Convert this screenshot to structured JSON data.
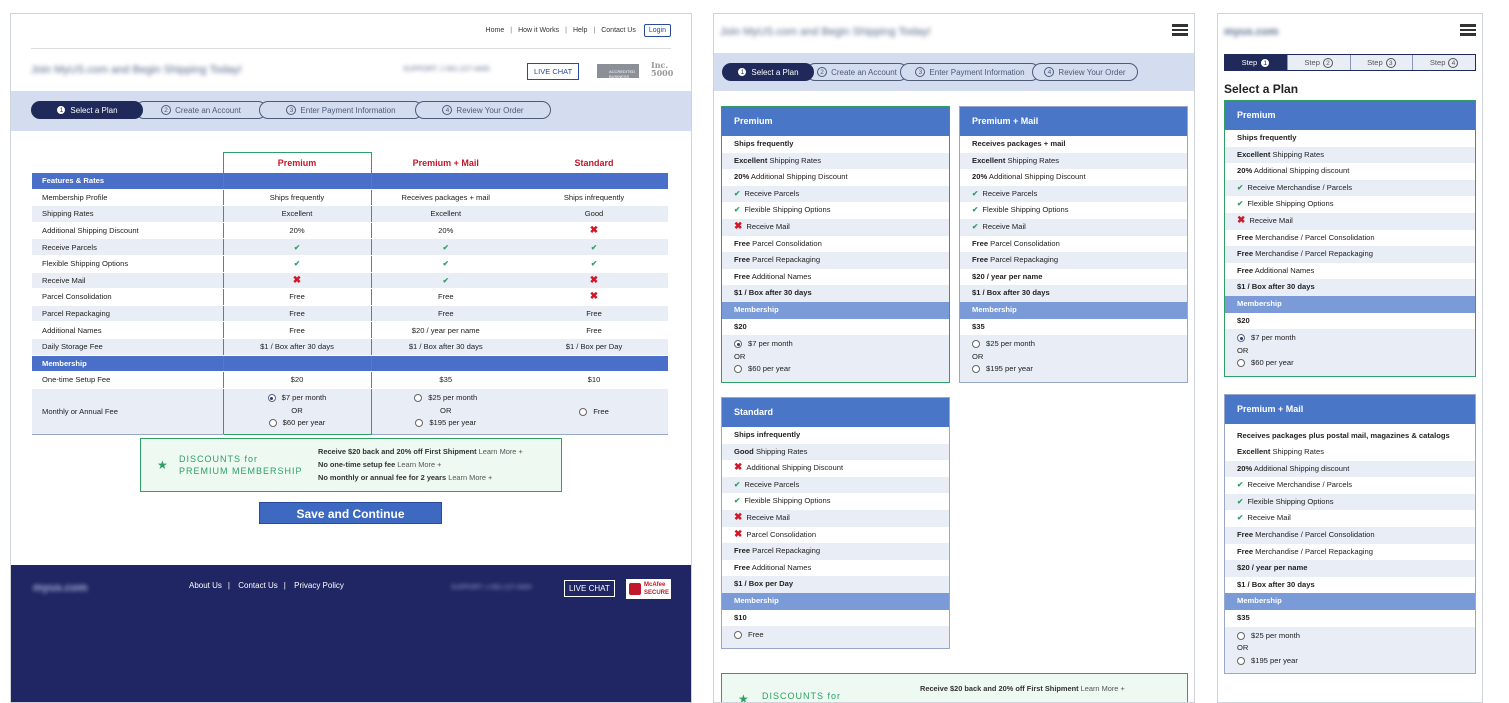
{
  "nav": {
    "home": "Home",
    "how": "How it Works",
    "help": "Help",
    "contact": "Contact Us",
    "login": "Login"
  },
  "brand": {
    "tagline": "Join MyUS.com and Begin Shipping Today!",
    "support": "SUPPORT: 1-561-227-4400",
    "live_chat": "LIVE CHAT",
    "inc": "Inc. 5000",
    "bbb": "ACCREDITED BUSINESS"
  },
  "steps": [
    {
      "num": "1",
      "label": "Select a Plan"
    },
    {
      "num": "2",
      "label": "Create an Account"
    },
    {
      "num": "3",
      "label": "Enter Payment Information"
    },
    {
      "num": "4",
      "label": "Review Your Order"
    }
  ],
  "plans": [
    "Premium",
    "Premium + Mail",
    "Standard"
  ],
  "table": {
    "features_header": "Features & Rates",
    "membership_header": "Membership",
    "rows": [
      {
        "label": "Membership Profile",
        "cells": [
          "Ships frequently",
          "Receives packages + mail",
          "Ships infrequently"
        ]
      },
      {
        "label": "Shipping Rates",
        "cells": [
          "Excellent",
          "Excellent",
          "Good"
        ]
      },
      {
        "label": "Additional Shipping Discount",
        "cells": [
          "20%",
          "20%",
          "✖"
        ]
      },
      {
        "label": "Receive Parcels",
        "cells": [
          "✔",
          "✔",
          "✔"
        ]
      },
      {
        "label": "Flexible Shipping Options",
        "cells": [
          "✔",
          "✔",
          "✔"
        ]
      },
      {
        "label": "Receive Mail",
        "cells": [
          "✖",
          "✔",
          "✖"
        ]
      },
      {
        "label": "Parcel Consolidation",
        "cells": [
          "Free",
          "Free",
          "✖"
        ]
      },
      {
        "label": "Parcel Repackaging",
        "cells": [
          "Free",
          "Free",
          "Free"
        ]
      },
      {
        "label": "Additional Names",
        "cells": [
          "Free",
          "$20 / year per name",
          "Free"
        ]
      },
      {
        "label": "Daily Storage Fee",
        "cells": [
          "$1 / Box after 30 days",
          "$1 / Box after 30 days",
          "$1 / Box per Day"
        ]
      }
    ],
    "setup_label": "One-time Setup Fee",
    "setup": [
      "$20",
      "$35",
      "$10"
    ],
    "fee_label": "Monthly or Annual Fee",
    "or": "OR",
    "fees": {
      "premium": [
        "$7 per month",
        "$60 per year"
      ],
      "premium_mail": [
        "$25 per month",
        "$195 per year"
      ],
      "standard": "Free"
    }
  },
  "discount": {
    "title_1": "DISCOUNTS for",
    "title_2": "PREMIUM MEMBERSHIP",
    "line1": "Receive $20 back and 20% off First Shipment",
    "line2": "No one-time setup fee",
    "line3": "No monthly or annual fee for 2 years",
    "learn": "Learn More +"
  },
  "save_label": "Save and Continue",
  "footer": {
    "about": "About Us",
    "contact": "Contact Us",
    "privacy": "Privacy Policy",
    "live_chat": "LIVE CHAT",
    "mcafee_1": "McAfee",
    "mcafee_2": "SECURE",
    "logo": "myus.com",
    "support": "SUPPORT: 1-561-227-4400"
  },
  "tablet": {
    "premium": {
      "title": "Premium",
      "rows": [
        [
          "",
          "Ships frequently"
        ],
        [
          "Excellent",
          "Shipping Rates"
        ],
        [
          "20%",
          "Additional Shipping Discount"
        ],
        [
          "✔",
          "Receive Parcels"
        ],
        [
          "✔",
          "Flexible Shipping Options"
        ],
        [
          "✖",
          "Receive Mail"
        ],
        [
          "Free",
          "Parcel Consolidation"
        ],
        [
          "Free",
          "Parcel Repackaging"
        ],
        [
          "Free",
          "Additional Names"
        ],
        [
          "",
          "$1 / Box after 30 days"
        ]
      ],
      "membership": "Membership",
      "setup": "$20",
      "fee1": "$7 per month",
      "or": "OR",
      "fee2": "$60 per year"
    },
    "premium_mail": {
      "title": "Premium + Mail",
      "rows": [
        [
          "",
          "Receives packages + mail"
        ],
        [
          "Excellent",
          "Shipping Rates"
        ],
        [
          "20%",
          "Additional Shipping Discount"
        ],
        [
          "✔",
          "Receive Parcels"
        ],
        [
          "✔",
          "Flexible Shipping Options"
        ],
        [
          "✔",
          "Receive Mail"
        ],
        [
          "Free",
          "Parcel Consolidation"
        ],
        [
          "Free",
          "Parcel Repackaging"
        ],
        [
          "",
          "$20 / year per name"
        ],
        [
          "",
          "$1 / Box after 30 days"
        ]
      ],
      "membership": "Membership",
      "setup": "$35",
      "fee1": "$25 per month",
      "or": "OR",
      "fee2": "$195 per year"
    },
    "standard": {
      "title": "Standard",
      "rows": [
        [
          "",
          "Ships infrequently"
        ],
        [
          "Good",
          "Shipping Rates"
        ],
        [
          "✖",
          "Additional Shipping Discount"
        ],
        [
          "✔",
          "Receive Parcels"
        ],
        [
          "✔",
          "Flexible Shipping Options"
        ],
        [
          "✖",
          "Receive Mail"
        ],
        [
          "✖",
          "Parcel Consolidation"
        ],
        [
          "Free",
          "Parcel Repackaging"
        ],
        [
          "Free",
          "Additional Names"
        ],
        [
          "",
          "$1 / Box per Day"
        ]
      ],
      "membership": "Membership",
      "setup": "$10",
      "fee1": "Free"
    },
    "discount_title": "DISCOUNTS for",
    "discount_line": "Receive $20 back and 20% off First Shipment",
    "learn": "Learn More +"
  },
  "mobile": {
    "tabs": [
      {
        "label": "Step",
        "num": "1"
      },
      {
        "label": "Step",
        "num": "2"
      },
      {
        "label": "Step",
        "num": "3"
      },
      {
        "label": "Step",
        "num": "4"
      }
    ],
    "heading": "Select a Plan",
    "premium": {
      "title": "Premium",
      "rows": [
        [
          "",
          "Ships frequently"
        ],
        [
          "Excellent",
          "Shipping Rates"
        ],
        [
          "20%",
          "Additional Shipping discount"
        ],
        [
          "✔",
          "Receive Merchandise / Parcels"
        ],
        [
          "✔",
          "Flexible Shipping Options"
        ],
        [
          "✖",
          "Receive Mail"
        ],
        [
          "Free",
          "Merchandise / Parcel Consolidation"
        ],
        [
          "Free",
          "Merchandise / Parcel Repackaging"
        ],
        [
          "Free",
          "Additional Names"
        ],
        [
          "",
          "$1 / Box after 30 days"
        ]
      ],
      "membership": "Membership",
      "setup": "$20",
      "fee1": "$7 per month",
      "or": "OR",
      "fee2": "$60 per year"
    },
    "premium_mail": {
      "title": "Premium + Mail",
      "desc": "Receives packages plus postal mail, magazines & catalogs",
      "rows": [
        [
          "Excellent",
          "Shipping Rates"
        ],
        [
          "20%",
          "Additional Shipping discount"
        ],
        [
          "✔",
          "Receive Merchandise / Parcels"
        ],
        [
          "✔",
          "Flexible Shipping Options"
        ],
        [
          "✔",
          "Receive Mail"
        ],
        [
          "Free",
          "Merchandise / Parcel Consolidation"
        ],
        [
          "Free",
          "Merchandise / Parcel Repackaging"
        ],
        [
          "",
          "$20 / year per name"
        ],
        [
          "",
          "$1 / Box after 30 days"
        ]
      ],
      "membership": "Membership",
      "setup": "$35",
      "fee1": "$25 per month",
      "or": "OR",
      "fee2": "$195 per year"
    }
  }
}
